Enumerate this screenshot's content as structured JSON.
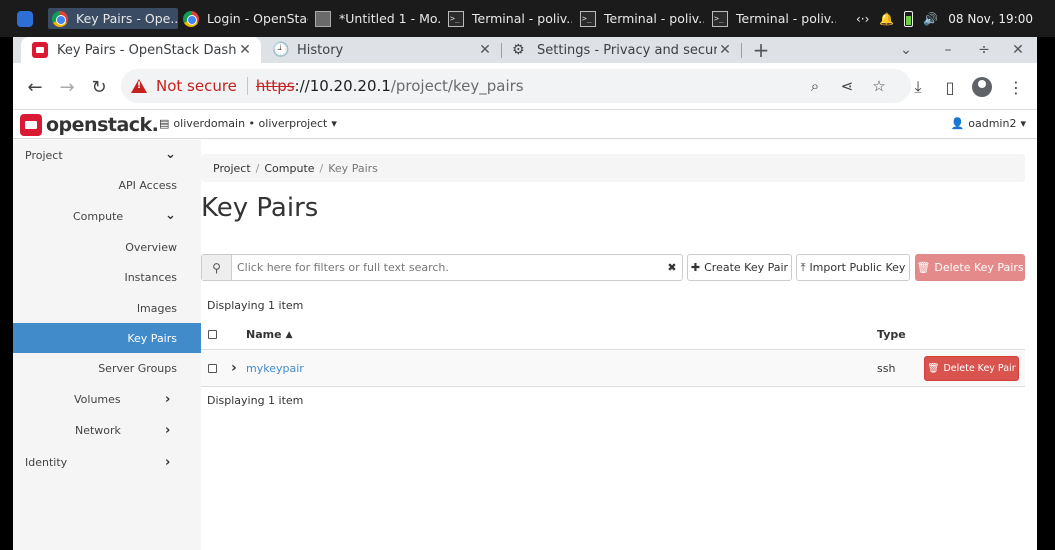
{
  "taskbar": {
    "items": [
      {
        "label": "Key Pairs - Ope..."
      },
      {
        "label": "Login - OpenStac..."
      },
      {
        "label": "*Untitled 1 - Mo..."
      },
      {
        "label": "Terminal - poliv..."
      },
      {
        "label": "Terminal - poliv..."
      },
      {
        "label": "Terminal - poliv..."
      }
    ],
    "clock": "08 Nov, 19:00"
  },
  "browser": {
    "tabs": [
      {
        "title": "Key Pairs - OpenStack Dashboard"
      },
      {
        "title": "History"
      },
      {
        "title": "Settings - Privacy and security"
      }
    ],
    "security_label": "Not secure",
    "url_scheme": "https",
    "url_host": "://10.20.20.1",
    "url_path": "/project/key_pairs"
  },
  "header": {
    "logo_text": "openstack.",
    "project_selector": "oliverdomain • oliverproject",
    "user": "oadmin2"
  },
  "sidebar": {
    "project": "Project",
    "api_access": "API Access",
    "compute": "Compute",
    "overview": "Overview",
    "instances": "Instances",
    "images": "Images",
    "key_pairs": "Key Pairs",
    "server_groups": "Server Groups",
    "volumes": "Volumes",
    "network": "Network",
    "identity": "Identity"
  },
  "breadcrumb": {
    "items": [
      "Project",
      "Compute",
      "Key Pairs"
    ]
  },
  "page_title": "Key Pairs",
  "toolbar": {
    "search_placeholder": "Click here for filters or full text search.",
    "create_label": "Create Key Pair",
    "import_label": "Import Public Key",
    "delete_label": "Delete Key Pairs"
  },
  "table": {
    "count_top": "Displaying 1 item",
    "count_bottom": "Displaying 1 item",
    "columns": {
      "name": "Name",
      "type": "Type"
    },
    "rows": [
      {
        "name": "mykeypair",
        "type": "ssh",
        "action": "Delete Key Pair"
      }
    ]
  },
  "colors": {
    "accent": "#428bca",
    "danger": "#d9534f",
    "brand": "#da1a32"
  }
}
